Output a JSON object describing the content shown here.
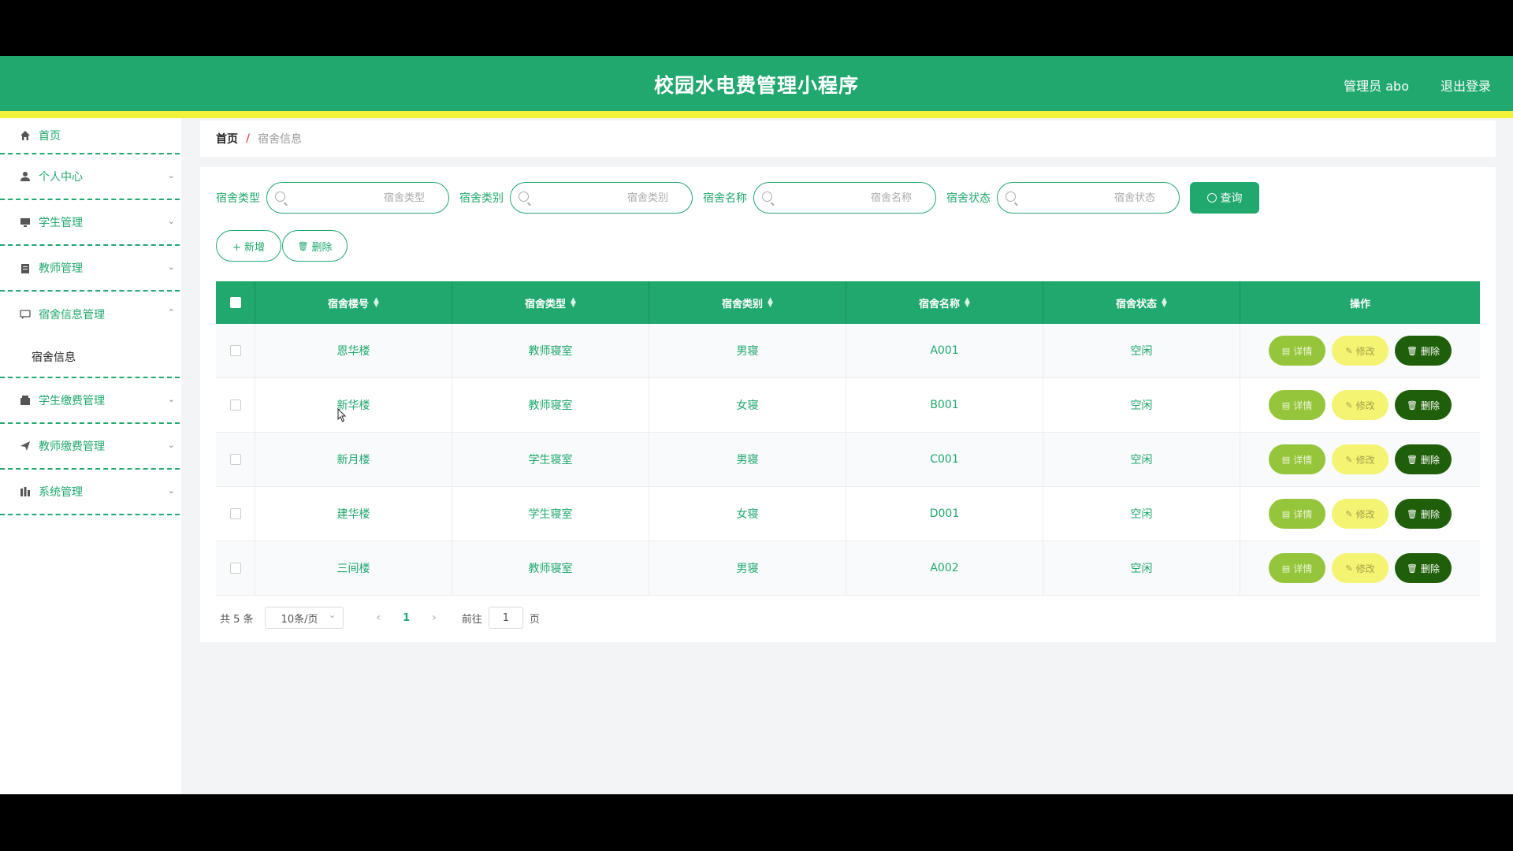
{
  "header": {
    "title": "校园水电费管理小程序",
    "user": "管理员 abo",
    "logout": "退出登录"
  },
  "sidebar": {
    "items": [
      {
        "label": "首页",
        "icon": "home-icon"
      },
      {
        "label": "个人中心",
        "icon": "user-icon"
      },
      {
        "label": "学生管理",
        "icon": "monitor-icon"
      },
      {
        "label": "教师管理",
        "icon": "clipboard-icon"
      },
      {
        "label": "宿舍信息管理",
        "icon": "chat-icon"
      },
      {
        "label": "学生缴费管理",
        "icon": "wallet-icon"
      },
      {
        "label": "教师缴费管理",
        "icon": "send-icon"
      },
      {
        "label": "系统管理",
        "icon": "chart-icon"
      }
    ],
    "submenu": "宿舍信息"
  },
  "breadcrumb": {
    "home": "首页",
    "separator": "/",
    "current": "宿舍信息"
  },
  "search": {
    "fields": [
      {
        "label": "宿舍类型",
        "placeholder": "宿舍类型"
      },
      {
        "label": "宿舍类别",
        "placeholder": "宿舍类别"
      },
      {
        "label": "宿舍名称",
        "placeholder": "宿舍名称"
      },
      {
        "label": "宿舍状态",
        "placeholder": "宿舍状态"
      }
    ],
    "button": "查询"
  },
  "actions": {
    "add": "+ 新增",
    "delete": "删除"
  },
  "table": {
    "columns": [
      "宿舍楼号",
      "宿舍类型",
      "宿舍类别",
      "宿舍名称",
      "宿舍状态",
      "操作"
    ],
    "rows": [
      [
        "恩华楼",
        "教师寝室",
        "男寝",
        "A001",
        "空闲"
      ],
      [
        "新华楼",
        "教师寝室",
        "女寝",
        "B001",
        "空闲"
      ],
      [
        "新月楼",
        "学生寝室",
        "男寝",
        "C001",
        "空闲"
      ],
      [
        "建华楼",
        "学生寝室",
        "女寝",
        "D001",
        "空闲"
      ],
      [
        "三间楼",
        "教师寝室",
        "男寝",
        "A002",
        "空闲"
      ]
    ],
    "op_labels": {
      "detail": "详情",
      "edit": "修改",
      "delete": "删除"
    }
  },
  "pagination": {
    "total": "共 5 条",
    "page_size": "10条/页",
    "current_page": "1",
    "goto_label": "前往",
    "goto_value": "1",
    "page_unit": "页"
  },
  "colors": {
    "primary": "#20a86e",
    "stripe": "#f2f23c",
    "detail": "#95c53b",
    "edit": "#f5f372",
    "delete": "#205f0a"
  }
}
